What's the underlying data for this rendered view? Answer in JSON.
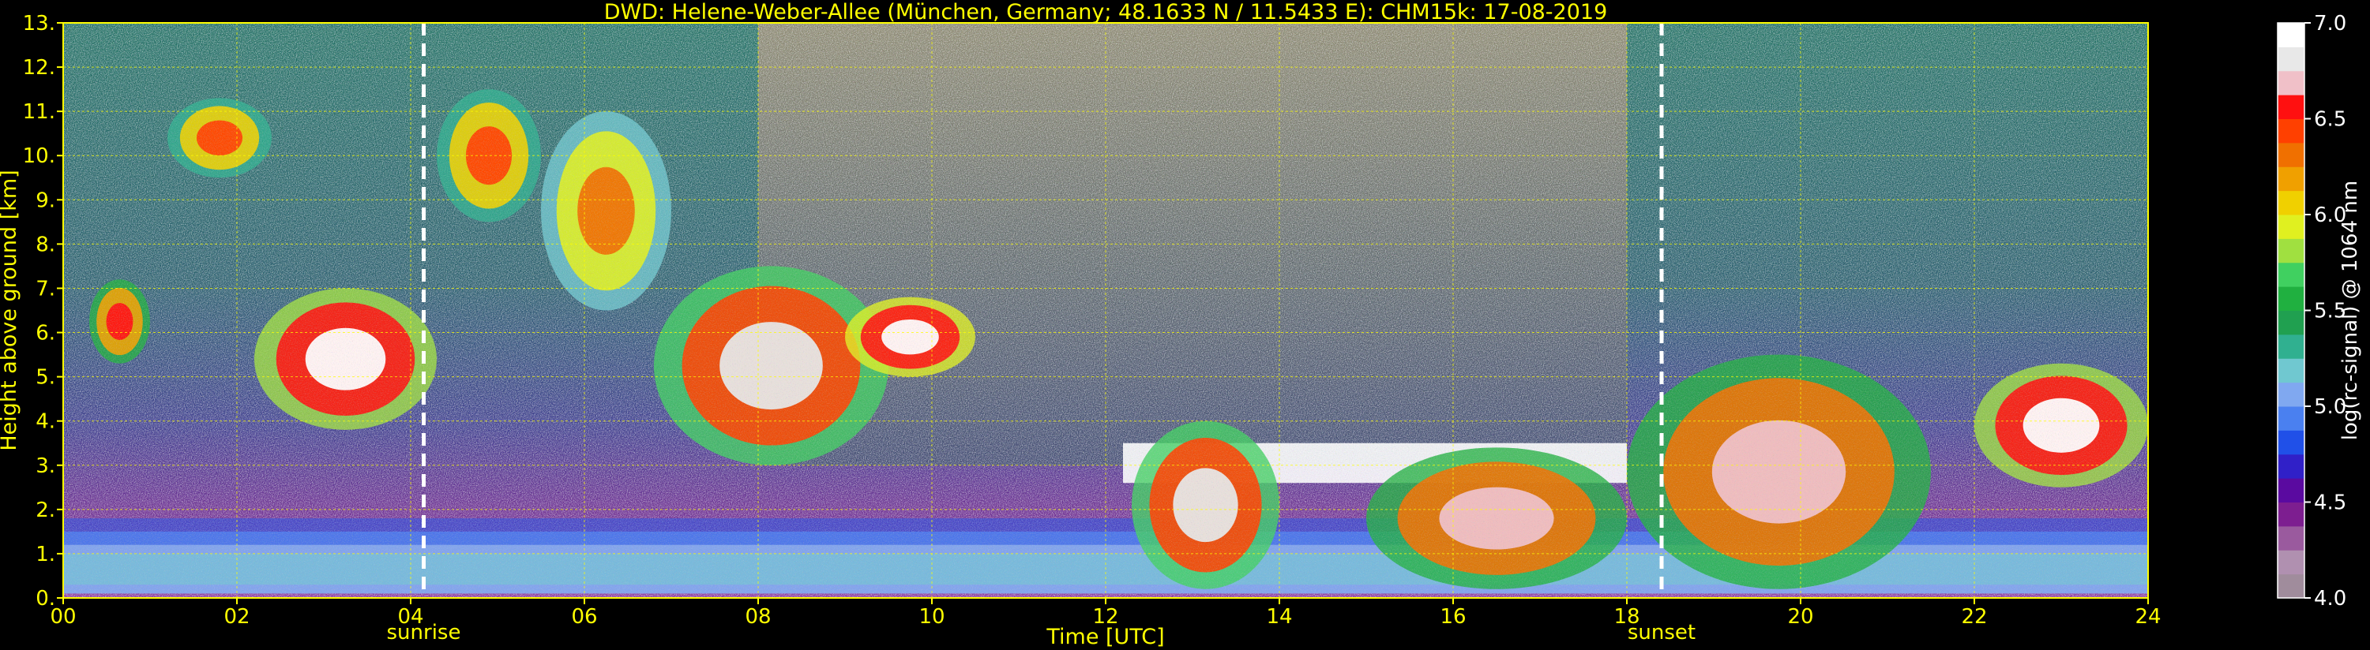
{
  "chart_data": {
    "type": "heatmap",
    "title": "DWD: Helene-Weber-Allee (München, Germany; 48.1633 N / 11.5433 E):    CHM15k: 17-08-2019",
    "xlabel": "Time [UTC]",
    "ylabel": "Height above ground [km]",
    "xlim": [
      0,
      24
    ],
    "ylim": [
      0,
      13
    ],
    "x_ticks": [
      0,
      2,
      4,
      6,
      8,
      10,
      12,
      14,
      16,
      18,
      20,
      22,
      24
    ],
    "x_tick_labels": [
      "00",
      "02",
      "04",
      "06",
      "08",
      "10",
      "12",
      "14",
      "16",
      "18",
      "20",
      "22",
      "24"
    ],
    "y_ticks": [
      0,
      1,
      2,
      3,
      4,
      5,
      6,
      7,
      8,
      9,
      10,
      11,
      12,
      13
    ],
    "y_tick_labels": [
      "0.",
      "1.",
      "2.",
      "3.",
      "4.",
      "5.",
      "6.",
      "7.",
      "8.",
      "9.",
      "10.",
      "11.",
      "12.",
      "13."
    ],
    "grid": true,
    "annotations": [
      {
        "label": "sunrise",
        "x": 4.15
      },
      {
        "label": "sunset",
        "x": 18.4
      }
    ],
    "colorbar": {
      "label": "log(rc-signal) @ 1064 nm",
      "range": [
        4.0,
        7.0
      ],
      "ticks": [
        4.0,
        4.5,
        5.0,
        5.5,
        6.0,
        6.5,
        7.0
      ],
      "tick_labels": [
        "4.0",
        "4.5",
        "5.0",
        "5.5",
        "6.0",
        "6.5",
        "7.0"
      ],
      "colors": [
        "#a08c9c",
        "#b090b0",
        "#9a5a9e",
        "#7d1e90",
        "#5a0aa0",
        "#3020c8",
        "#2050e8",
        "#4a80f0",
        "#80a8f0",
        "#70c8d0",
        "#30b090",
        "#20a050",
        "#20b040",
        "#40d060",
        "#a0e040",
        "#e0f020",
        "#f0d000",
        "#f0a000",
        "#f07000",
        "#ff4000",
        "#ff1010",
        "#f0c0c8",
        "#e8e8e8",
        "#ffffff"
      ]
    },
    "features": [
      {
        "kind": "aerosol_layer",
        "x": [
          0,
          24
        ],
        "y": [
          0.1,
          1.5
        ],
        "value": 5.05
      },
      {
        "kind": "boundary_layer_top",
        "x": [
          0,
          24
        ],
        "y": [
          1.2,
          1.8
        ],
        "value": 4.8
      },
      {
        "kind": "cloud_base_line",
        "x": [
          12.2,
          18.0
        ],
        "y": [
          2.6,
          3.5
        ],
        "value": 7.0
      },
      {
        "kind": "cirrus",
        "x": [
          0.3,
          1.0
        ],
        "y": [
          5.3,
          7.2
        ],
        "value": 6.6
      },
      {
        "kind": "cirrus",
        "x": [
          1.2,
          2.4
        ],
        "y": [
          9.5,
          11.3
        ],
        "value": 6.4
      },
      {
        "kind": "cirrus",
        "x": [
          2.2,
          4.3
        ],
        "y": [
          3.8,
          7.0
        ],
        "value": 6.9
      },
      {
        "kind": "cirrus",
        "x": [
          4.3,
          5.5
        ],
        "y": [
          8.5,
          11.5
        ],
        "value": 6.4
      },
      {
        "kind": "cirrus",
        "x": [
          5.5,
          7.0
        ],
        "y": [
          6.5,
          11.0
        ],
        "value": 6.3
      },
      {
        "kind": "cirrus",
        "x": [
          6.8,
          9.5
        ],
        "y": [
          3.0,
          7.5
        ],
        "value": 6.8
      },
      {
        "kind": "cirrus",
        "x": [
          9.0,
          10.5
        ],
        "y": [
          5.0,
          6.8
        ],
        "value": 7.0
      },
      {
        "kind": "low_cloud",
        "x": [
          12.3,
          14.0
        ],
        "y": [
          0.2,
          4.0
        ],
        "value": 6.8
      },
      {
        "kind": "low_cloud",
        "x": [
          15.0,
          18.0
        ],
        "y": [
          0.2,
          3.4
        ],
        "value": 6.7
      },
      {
        "kind": "low_cloud",
        "x": [
          18.0,
          21.5
        ],
        "y": [
          0.2,
          5.5
        ],
        "value": 6.7
      },
      {
        "kind": "altocumulus",
        "x": [
          22.0,
          24.0
        ],
        "y": [
          2.5,
          5.3
        ],
        "value": 6.9
      }
    ]
  }
}
